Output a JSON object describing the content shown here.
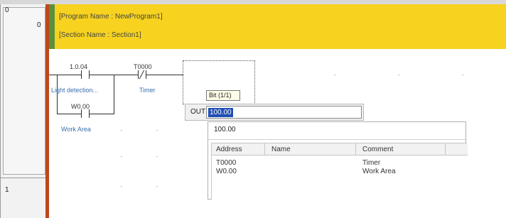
{
  "gutter": {
    "rung0_left": "0",
    "rung0_right": "0",
    "rung1": "1"
  },
  "banner": {
    "program_line": "[Program Name : NewProgram1]",
    "section_line": "[Section Name : Section1]"
  },
  "contacts": [
    {
      "operand": "1.0.04",
      "comment": "Light detection...",
      "type": "normally-open"
    },
    {
      "operand": "T0000",
      "comment": "Timer",
      "type": "normally-closed"
    },
    {
      "operand": "W0.00",
      "comment": "Work Area",
      "type": "normally-open"
    }
  ],
  "editor": {
    "tooltip": "Bit (1/1)",
    "instruction_label": "OUT",
    "input_value": "100.00"
  },
  "suggest": {
    "current_value": "100.00",
    "columns": [
      "Address",
      "Name",
      "Comment"
    ],
    "rows": [
      {
        "address": "T0000",
        "name": "",
        "comment": "Timer"
      },
      {
        "address": "W0.00",
        "name": "",
        "comment": "Work Area"
      }
    ]
  },
  "colors": {
    "banner": "#f7d21f",
    "banner_accent": "#5a8f3c",
    "power_rail": "#c0461b",
    "selection": "#1f4fb5",
    "comment_text": "#3a6fb0"
  }
}
